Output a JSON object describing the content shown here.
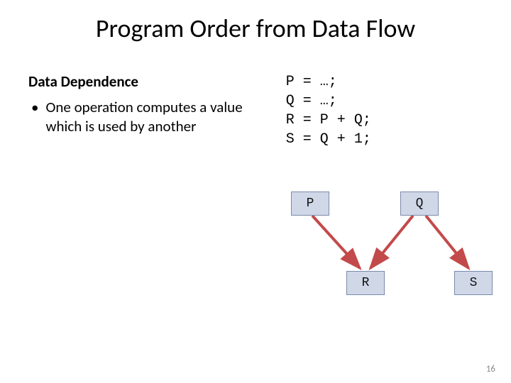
{
  "title": "Program Order from Data Flow",
  "subtitle": "Data Dependence",
  "bullet": "One operation computes a value which is used by another",
  "code": {
    "l1": "P = …;",
    "l2": "Q = …;",
    "l3": "R = P + Q;",
    "l4": "S = Q + 1;"
  },
  "nodes": {
    "p": "P",
    "q": "Q",
    "r": "R",
    "s": "S"
  },
  "slide_number": "16"
}
